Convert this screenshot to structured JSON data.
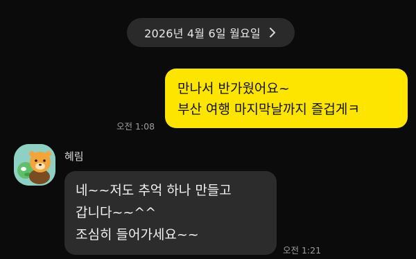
{
  "chat": {
    "date_divider": "2026년 4월 6일 월요일",
    "messages": [
      {
        "sender": "me",
        "lines": [
          "만나서 반가웠어요~",
          "부산 여행 마지막날까지 즐겁게ㅋ"
        ],
        "time": "오전 1:08",
        "bubble_color": "#fee500"
      },
      {
        "sender": "them",
        "name": "혜림",
        "lines": [
          "네~~저도  추억 하나 만들고",
          "갑니다~~^^",
          "조심히 들어가세요~~"
        ],
        "time": "오전 1:21",
        "bubble_color": "#2c2c2c"
      }
    ]
  },
  "icons": {
    "date_chevron": "chevron-right-icon",
    "avatar": "profile-avatar"
  },
  "colors": {
    "background": "#0b0b0b",
    "my_bubble": "#fee500",
    "their_bubble": "#2c2c2c",
    "date_pill": "#2a2a2a"
  }
}
